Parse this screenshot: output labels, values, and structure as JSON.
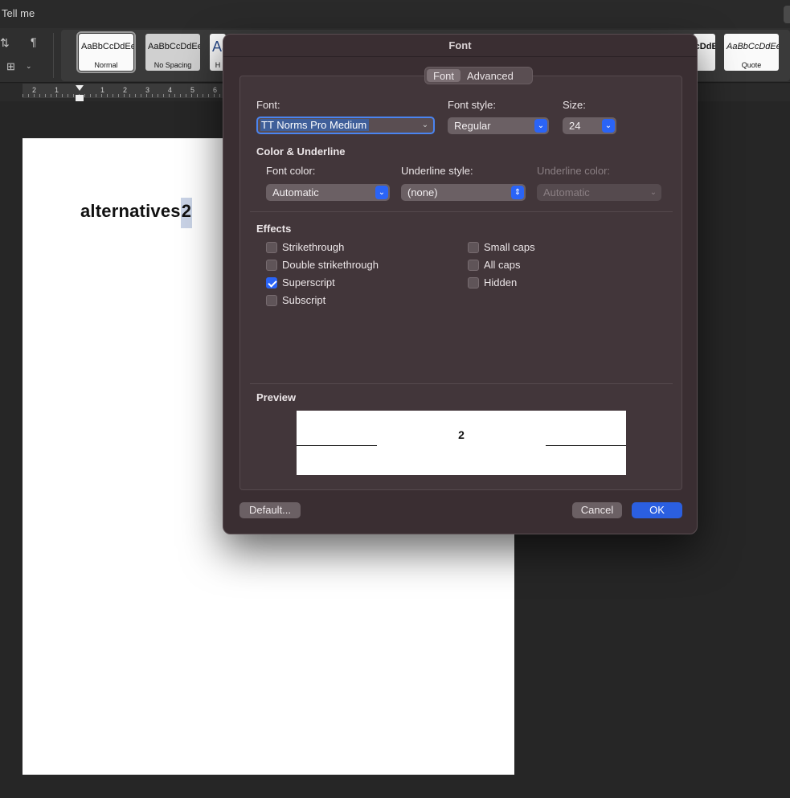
{
  "word": {
    "tell_me": "Tell me",
    "pilcrow": "¶",
    "styles": [
      {
        "sample": "AaBbCcDdEe",
        "name": "Normal"
      },
      {
        "sample": "AaBbCcDdEe",
        "name": "No Spacing"
      },
      {
        "sample": "Aa",
        "name": "H"
      },
      {
        "sample": "AaBbCcDdE",
        "name": ""
      },
      {
        "sample": "AaBbCcDdEe",
        "name": "Quote"
      }
    ],
    "ruler_numbers": [
      "2",
      "1",
      "1",
      "2",
      "3",
      "4",
      "5",
      "6"
    ],
    "document_text": "alternatives",
    "document_superscript": "2"
  },
  "dialog": {
    "title": "Font",
    "tabs": [
      "Font",
      "Advanced"
    ],
    "active_tab": "Font",
    "font_label": "Font:",
    "font_value": "TT Norms Pro Medium",
    "style_label": "Font style:",
    "style_value": "Regular",
    "size_label": "Size:",
    "size_value": "24",
    "color_section": "Color & Underline",
    "font_color_label": "Font color:",
    "font_color_value": "Automatic",
    "underline_style_label": "Underline style:",
    "underline_style_value": "(none)",
    "underline_color_label": "Underline color:",
    "underline_color_value": "Automatic",
    "effects_label": "Effects",
    "effects": {
      "strikethrough": {
        "label": "Strikethrough",
        "checked": false
      },
      "double_strikethrough": {
        "label": "Double strikethrough",
        "checked": false
      },
      "superscript": {
        "label": "Superscript",
        "checked": true
      },
      "subscript": {
        "label": "Subscript",
        "checked": false
      },
      "small_caps": {
        "label": "Small caps",
        "checked": false
      },
      "all_caps": {
        "label": "All caps",
        "checked": false
      },
      "hidden": {
        "label": "Hidden",
        "checked": false
      }
    },
    "preview_label": "Preview",
    "preview_text": "2",
    "default_button": "Default...",
    "cancel_button": "Cancel",
    "ok_button": "OK"
  },
  "colors": {
    "accent": "#2a64f6",
    "dialog_bg": "#3a2e32"
  }
}
